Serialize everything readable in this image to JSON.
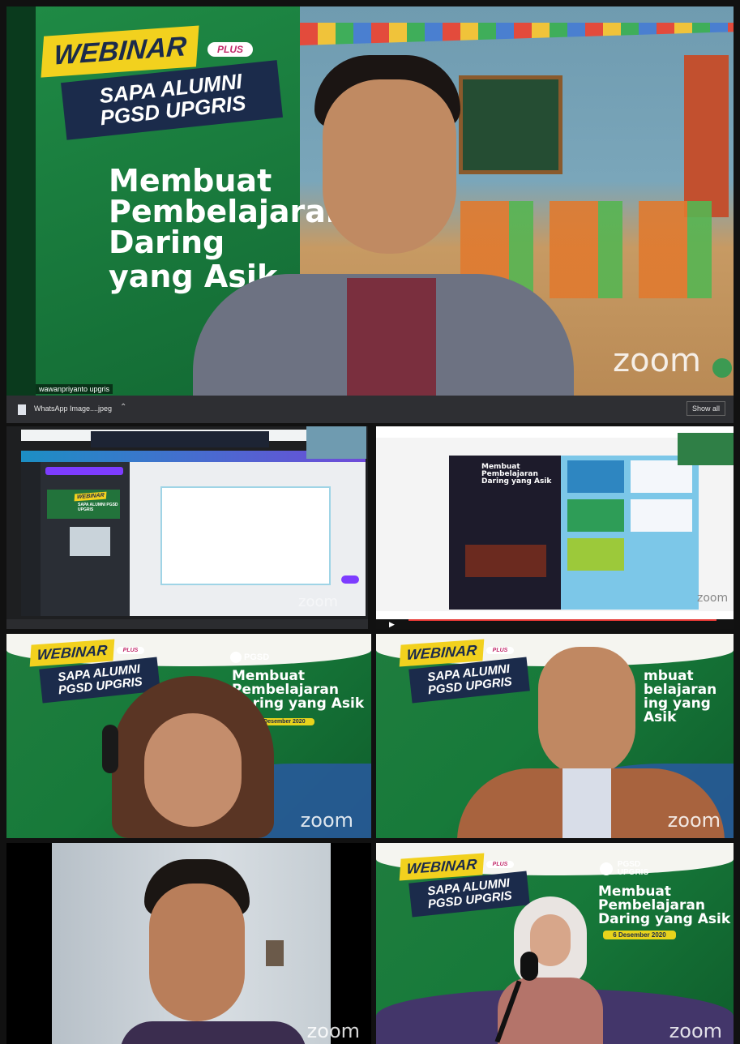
{
  "main_speaker": {
    "webinar": "WEBINAR",
    "plus": "PLUS",
    "banner_line1": "SAPA ALUMNI",
    "banner_line2": "PGSD UPGRIS",
    "title_line1": "Membuat",
    "title_line2": "Pembelajaran",
    "title_line3": "Daring",
    "title_line4": "yang Asik",
    "name": "wawanpriyanto upgris",
    "zoom": "zoom"
  },
  "download_bar": {
    "file_name": "WhatsApp Image....jpeg",
    "show_all": "Show all"
  },
  "share_tile_1": {
    "webinar": "WEBINAR",
    "banner": "SAPA ALUMNI PGSD UPGRIS",
    "zoom": "zoom"
  },
  "share_tile_2": {
    "title_line1": "Membuat",
    "title_line2": "Pembelajaran",
    "title_line3": "Daring yang Asik",
    "zoom": "zoom"
  },
  "tile_3": {
    "webinar": "WEBINAR",
    "plus": "PLUS",
    "banner_line1": "SAPA ALUMNI",
    "banner_line2": "PGSD UPGRIS",
    "logo_text": "PGSD",
    "title_line1": "Membuat",
    "title_line2": "Pembelajaran",
    "title_line3": "Daring yang Asik",
    "date": "6 Desember 2020",
    "zoom": "zoom"
  },
  "tile_4": {
    "webinar": "WEBINAR",
    "plus": "PLUS",
    "banner_line1": "SAPA ALUMNI",
    "banner_line2": "PGSD UPGRIS",
    "title_line1": "mbuat",
    "title_line2": "belajaran",
    "title_line3": "ing yang Asik",
    "zoom": "zoom"
  },
  "tile_5": {
    "zoom": "zoom"
  },
  "tile_6": {
    "webinar": "WEBINAR",
    "plus": "PLUS",
    "banner_line1": "SAPA ALUMNI",
    "banner_line2": "PGSD UPGRIS",
    "logo_line1": "PGSD",
    "logo_line2": "UPGRIS",
    "title_line1": "Membuat",
    "title_line2": "Pembelajaran",
    "title_line3": "Daring yang Asik",
    "date": "6 Desember 2020",
    "zoom": "zoom"
  }
}
